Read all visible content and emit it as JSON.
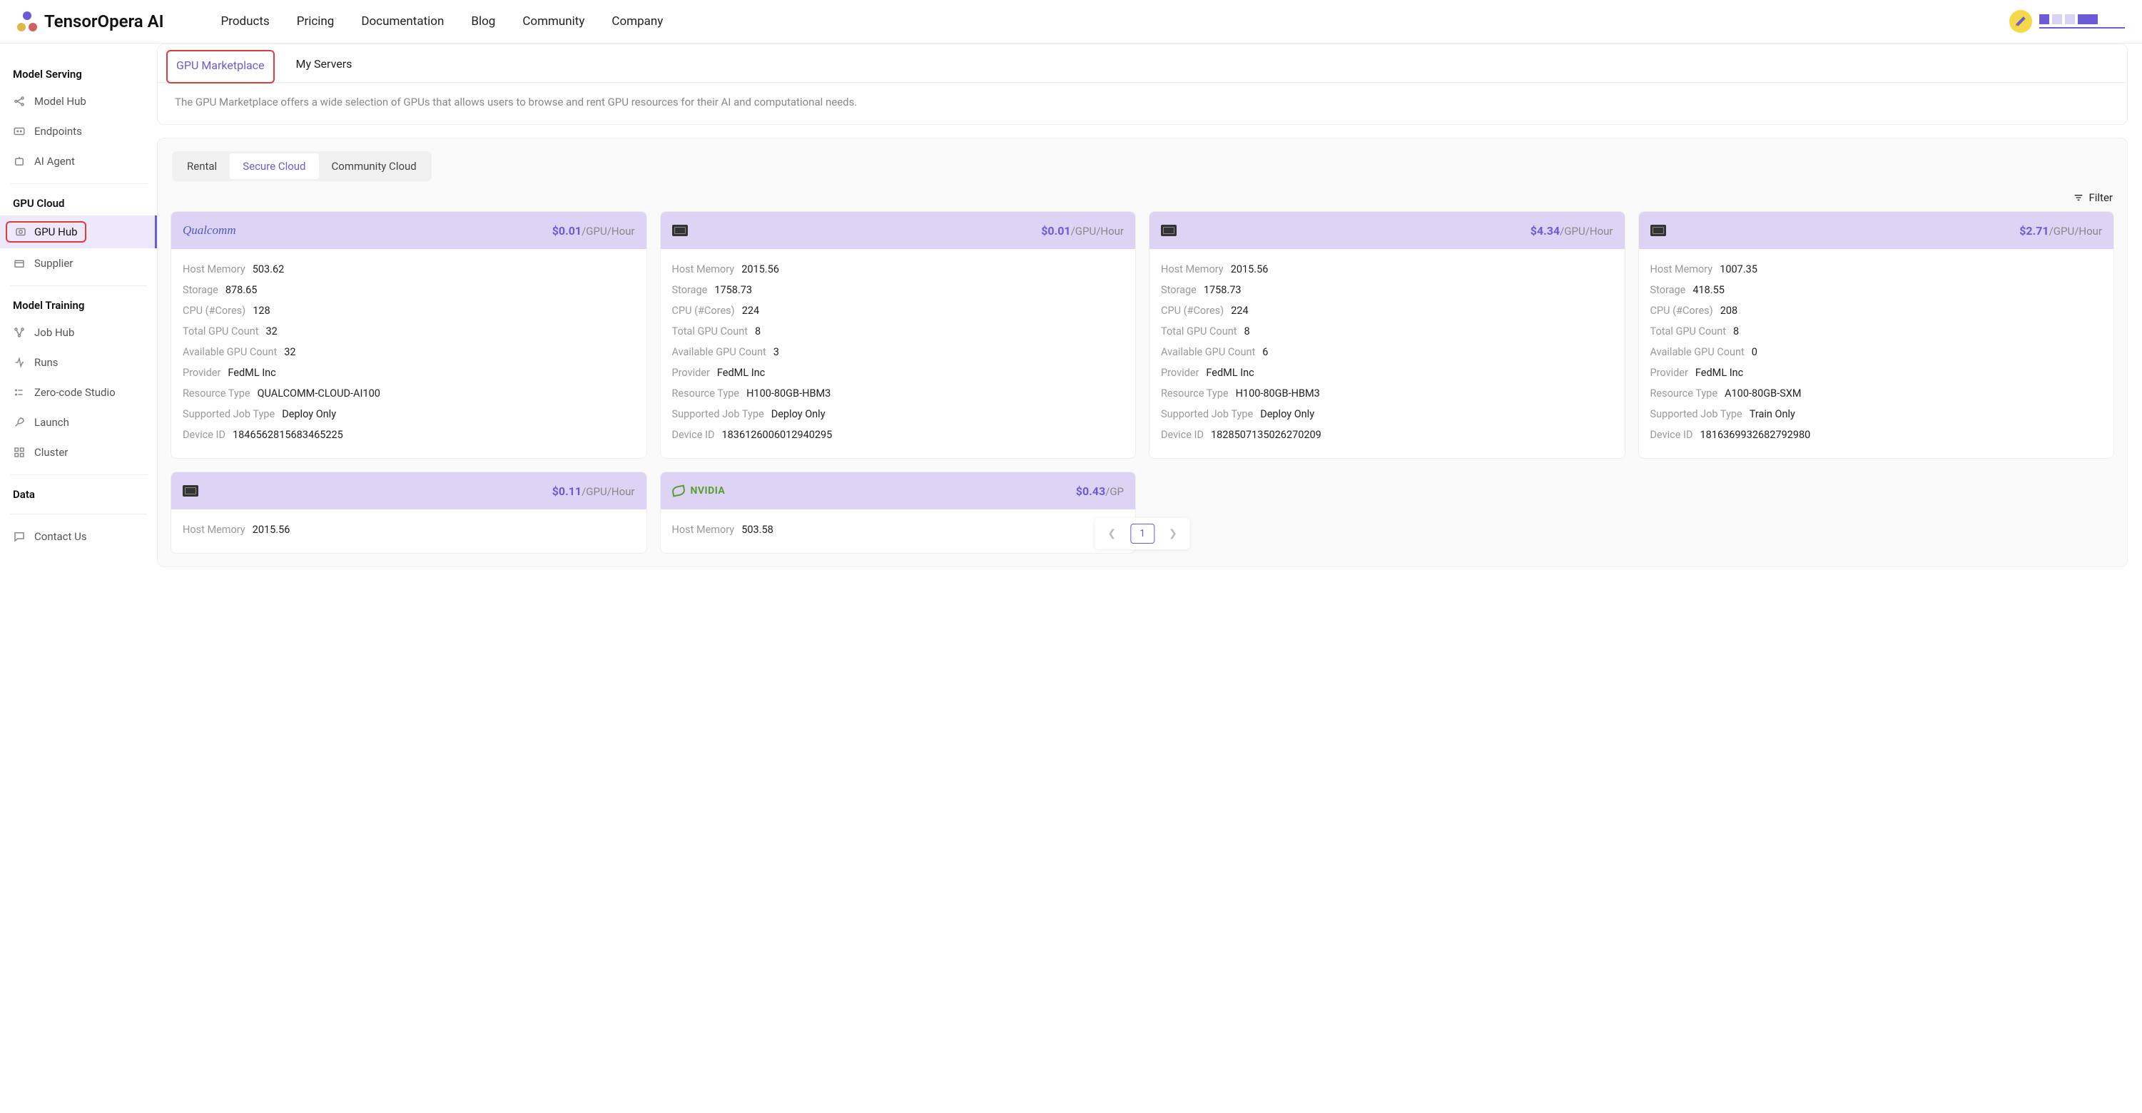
{
  "brand": "TensorOpera AI",
  "nav": [
    "Products",
    "Pricing",
    "Documentation",
    "Blog",
    "Community",
    "Company"
  ],
  "sidebar": {
    "sections": [
      {
        "title": "Model Serving",
        "items": [
          "Model Hub",
          "Endpoints",
          "AI Agent"
        ]
      },
      {
        "title": "GPU Cloud",
        "items": [
          "GPU Hub",
          "Supplier"
        ]
      },
      {
        "title": "Model Training",
        "items": [
          "Job Hub",
          "Runs",
          "Zero-code Studio",
          "Launch",
          "Cluster"
        ]
      },
      {
        "title": "Data",
        "items": [
          "Contact Us"
        ]
      }
    ]
  },
  "tabs": {
    "marketplace": "GPU Marketplace",
    "myservers": "My Servers"
  },
  "description": "The GPU Marketplace offers a wide selection of GPUs that allows users to browse and rent GPU resources for their AI and computational needs.",
  "subtabs": {
    "rental": "Rental",
    "secure": "Secure Cloud",
    "community": "Community Cloud"
  },
  "filter_label": "Filter",
  "price_suffix": "/GPU/Hour",
  "spec_labels": {
    "host_memory": "Host Memory",
    "storage": "Storage",
    "cpu": "CPU (#Cores)",
    "total_gpu": "Total GPU Count",
    "avail_gpu": "Available GPU Count",
    "provider": "Provider",
    "resource_type": "Resource Type",
    "job_type": "Supported Job Type",
    "device_id": "Device ID"
  },
  "cards": [
    {
      "logo": "Qualcomm",
      "logo_type": "qualcomm",
      "price": "$0.01",
      "host_memory": "503.62",
      "storage": "878.65",
      "cpu": "128",
      "total_gpu": "32",
      "avail_gpu": "32",
      "provider": "FedML Inc",
      "resource_type": "QUALCOMM-CLOUD-AI100",
      "job_type": "Deploy Only",
      "device_id": "1846562815683465225"
    },
    {
      "logo": "",
      "logo_type": "chip",
      "price": "$0.01",
      "host_memory": "2015.56",
      "storage": "1758.73",
      "cpu": "224",
      "total_gpu": "8",
      "avail_gpu": "3",
      "provider": "FedML Inc",
      "resource_type": "H100-80GB-HBM3",
      "job_type": "Deploy Only",
      "device_id": "1836126006012940295"
    },
    {
      "logo": "",
      "logo_type": "chip",
      "price": "$4.34",
      "host_memory": "2015.56",
      "storage": "1758.73",
      "cpu": "224",
      "total_gpu": "8",
      "avail_gpu": "6",
      "provider": "FedML Inc",
      "resource_type": "H100-80GB-HBM3",
      "job_type": "Deploy Only",
      "device_id": "1828507135026270209"
    },
    {
      "logo": "",
      "logo_type": "chip",
      "price": "$2.71",
      "host_memory": "1007.35",
      "storage": "418.55",
      "cpu": "208",
      "total_gpu": "8",
      "avail_gpu": "0",
      "provider": "FedML Inc",
      "resource_type": "A100-80GB-SXM",
      "job_type": "Train Only",
      "device_id": "1816369932682792980"
    },
    {
      "logo": "",
      "logo_type": "chip",
      "price": "$0.11",
      "host_memory": "2015.56"
    },
    {
      "logo": "NVIDIA",
      "logo_type": "nvidia",
      "price": "$0.43",
      "host_memory": "503.58"
    }
  ],
  "pagination": {
    "page": "1"
  }
}
